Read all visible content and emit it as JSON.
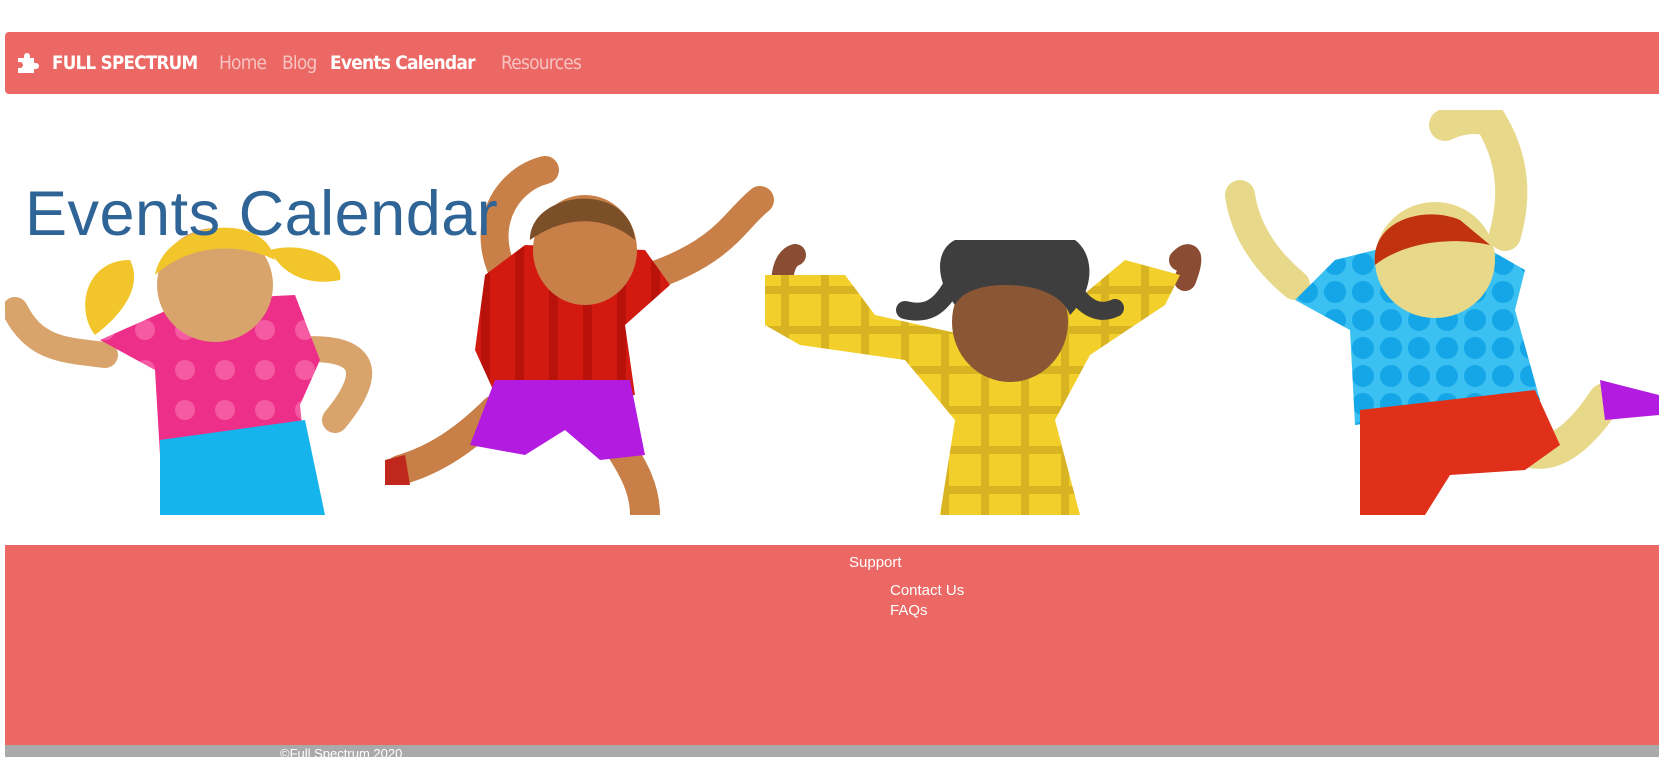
{
  "navbar": {
    "brand_label": "FULL SPECTRUM",
    "brand_icon": "puzzle-piece-icon",
    "links": [
      {
        "label": "Home",
        "active": false
      },
      {
        "label": "Blog",
        "active": false
      },
      {
        "label": "Events Calendar",
        "active": true
      },
      {
        "label": "Resources",
        "active": false
      }
    ]
  },
  "hero": {
    "title": "Events Calendar",
    "image": "dancing-children-illustration"
  },
  "footer": {
    "heading": "Support",
    "links": [
      "Contact Us",
      "FAQs"
    ],
    "copyright": "©Full Spectrum 2020"
  },
  "colors": {
    "brand": "#eb6864",
    "title": "#2f6496",
    "copyright_bar": "#aaaaaa"
  }
}
